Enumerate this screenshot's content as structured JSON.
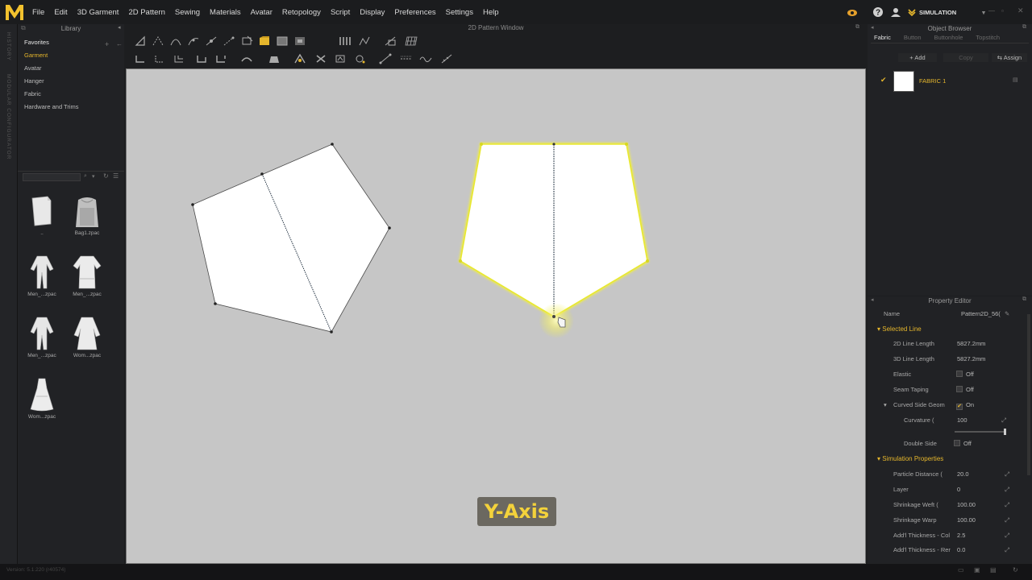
{
  "menu": [
    "File",
    "Edit",
    "3D Garment",
    "2D Pattern",
    "Sewing",
    "Materials",
    "Avatar",
    "Retopology",
    "Script",
    "Display",
    "Preferences",
    "Settings",
    "Help"
  ],
  "mode": "SIMULATION",
  "side_labels": {
    "history": "HISTORY",
    "modular": "MODULAR CONFIGURATOR"
  },
  "library": {
    "title": "Library",
    "tree": [
      "Favorites",
      "Garment",
      "Avatar",
      "Hanger",
      "Fabric",
      "Hardware and Trims"
    ],
    "thumbs": [
      {
        "label": ".."
      },
      {
        "label": "Bag1.zpac"
      },
      {
        "label": "Men_...zpac"
      },
      {
        "label": "Men_...zpac"
      },
      {
        "label": "Men_...zpac"
      },
      {
        "label": "Wom...zpac"
      },
      {
        "label": "Wom...zpac"
      }
    ]
  },
  "pattern_window": {
    "title": "2D Pattern Window",
    "overlay": "Y-Axis"
  },
  "object_browser": {
    "title": "Object Browser",
    "tabs": [
      "Fabric",
      "Button",
      "Buttonhole",
      "Topstitch"
    ],
    "add": "Add",
    "copy": "Copy",
    "assign": "Assign",
    "fabric_name": "FABRIC 1"
  },
  "property_editor": {
    "title": "Property Editor",
    "name_label": "Name",
    "name_value": "Pattern2D_56(",
    "sections": {
      "selected_line": "Selected Line",
      "simulation": "Simulation Properties"
    },
    "rows": {
      "line2d": {
        "label": "2D Line Length",
        "value": "5827.2mm"
      },
      "line3d": {
        "label": "3D Line Length",
        "value": "5827.2mm"
      },
      "elastic": {
        "label": "Elastic",
        "value": "Off"
      },
      "seam": {
        "label": "Seam Taping",
        "value": "Off"
      },
      "curved": {
        "label": "Curved Side Geom",
        "value": "On"
      },
      "curvature": {
        "label": "Curvature (",
        "value": "100"
      },
      "double": {
        "label": "Double Side",
        "value": "Off"
      },
      "particle": {
        "label": "Particle Distance (",
        "value": "20.0"
      },
      "layer": {
        "label": "Layer",
        "value": "0"
      },
      "weft": {
        "label": "Shrinkage Weft (",
        "value": "100.00"
      },
      "warp": {
        "label": "Shrinkage Warp",
        "value": "100.00"
      },
      "thick1": {
        "label": "Add'l Thickness - Col",
        "value": "2.5"
      },
      "thick2": {
        "label": "Add'l Thickness - Rer",
        "value": "0.0"
      }
    }
  },
  "status": {
    "version": "Version: 5.1.220 (r40574)"
  },
  "colors": {
    "accent": "#e5b62c",
    "canvas": "#c6c6c6",
    "highlight": "#f0f030"
  }
}
